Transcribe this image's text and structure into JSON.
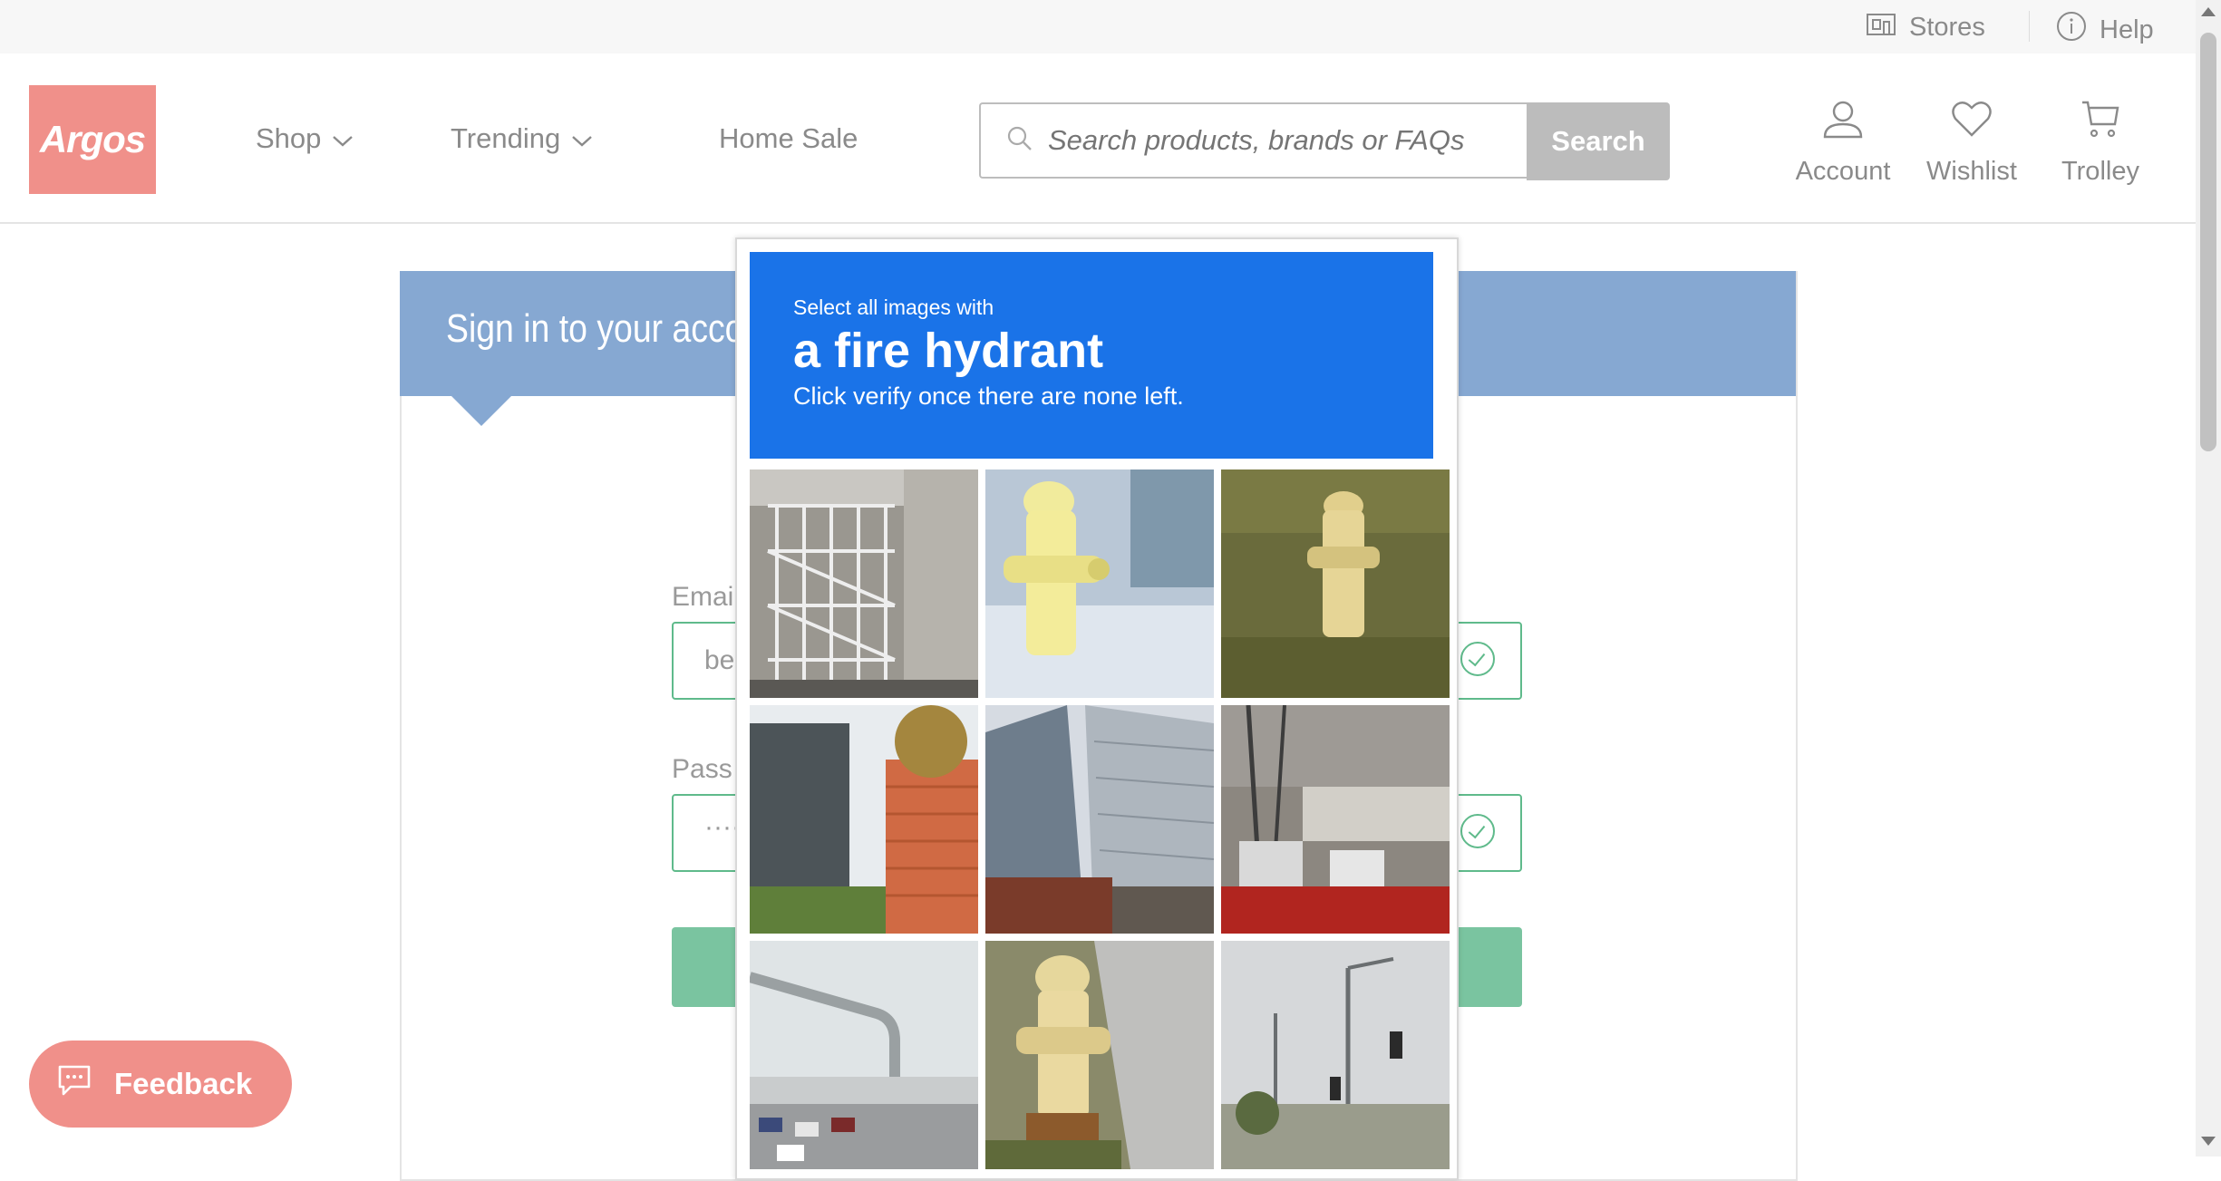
{
  "utility": {
    "stores_label": "Stores",
    "help_label": "Help"
  },
  "header": {
    "logo_text": "Argos",
    "nav": [
      {
        "label": "Shop",
        "has_dropdown": true
      },
      {
        "label": "Trending",
        "has_dropdown": true
      },
      {
        "label": "Home Sale",
        "has_dropdown": false
      }
    ],
    "search": {
      "placeholder": "Search products, brands or FAQs",
      "button_label": "Search"
    },
    "icons": [
      {
        "label": "Account",
        "icon": "account-icon"
      },
      {
        "label": "Wishlist",
        "icon": "heart-icon"
      },
      {
        "label": "Trolley",
        "icon": "trolley-icon"
      }
    ]
  },
  "signin": {
    "title": "Sign in to your accou",
    "email_label": "Emai",
    "email_value": "be",
    "password_label": "Pass",
    "password_value": "·····"
  },
  "feedback": {
    "label": "Feedback"
  },
  "captcha": {
    "instruction_small": "Select all images with",
    "target": "a fire hydrant",
    "instruction_sub": "Click verify once there are none left.",
    "tiles": [
      {
        "content": "building-stairs"
      },
      {
        "content": "fire-hydrant-yellow"
      },
      {
        "content": "fire-hydrant-grass"
      },
      {
        "content": "house-fence"
      },
      {
        "content": "tall-buildings"
      },
      {
        "content": "street-vehicles"
      },
      {
        "content": "highway-pole"
      },
      {
        "content": "fire-hydrant-curb"
      },
      {
        "content": "traffic-lights"
      }
    ]
  },
  "colors": {
    "brand": "#f0908a",
    "signin_header": "#86a8d2",
    "captcha_header": "#1a73e8",
    "success": "#5fba8b"
  }
}
